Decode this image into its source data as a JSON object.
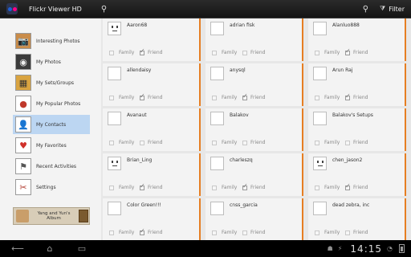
{
  "app": {
    "title": "Flickr Viewer HD",
    "filter_label": "Filter",
    "search_icon": "search-icon",
    "accent_color": "#e67e22"
  },
  "sidebar": {
    "items": [
      {
        "label": "Interesting Photos",
        "icon": "camera-icon"
      },
      {
        "label": "My Photos",
        "icon": "photo-icon"
      },
      {
        "label": "My Sets/Groups",
        "icon": "sets-icon"
      },
      {
        "label": "My Popular Photos",
        "icon": "popular-icon"
      },
      {
        "label": "My Contacts",
        "icon": "contacts-icon",
        "selected": true
      },
      {
        "label": "My Favorites",
        "icon": "heart-icon"
      },
      {
        "label": "Recent Activities",
        "icon": "activity-icon"
      },
      {
        "label": "Settings",
        "icon": "settings-icon"
      }
    ],
    "album": {
      "label": "Yang and Yun's Album"
    }
  },
  "contacts": {
    "checkbox_labels": {
      "family": "Family",
      "friend": "Friend"
    },
    "items": [
      {
        "name": "Aaron68",
        "family": false,
        "friend": true
      },
      {
        "name": "adrian fisk",
        "family": false,
        "friend": false
      },
      {
        "name": "Alanluo888",
        "family": false,
        "friend": true
      },
      {
        "name": "allendaisy",
        "family": false,
        "friend": true
      },
      {
        "name": "anysql",
        "family": false,
        "friend": true
      },
      {
        "name": "Arun Raj",
        "family": false,
        "friend": true
      },
      {
        "name": "Avanaut",
        "family": false,
        "friend": false
      },
      {
        "name": "Balakov",
        "family": false,
        "friend": false
      },
      {
        "name": "Balakov's Setups",
        "family": false,
        "friend": false
      },
      {
        "name": "Brian_Ling",
        "family": false,
        "friend": true
      },
      {
        "name": "charleszq",
        "family": false,
        "friend": true
      },
      {
        "name": "chen_jason2",
        "family": false,
        "friend": true
      },
      {
        "name": "Color Green!!!",
        "family": false,
        "friend": true
      },
      {
        "name": "cnss_garcia",
        "family": false,
        "friend": false
      },
      {
        "name": "dead zebra, inc",
        "family": false,
        "friend": false
      }
    ]
  },
  "system_bar": {
    "time": "14:15"
  }
}
